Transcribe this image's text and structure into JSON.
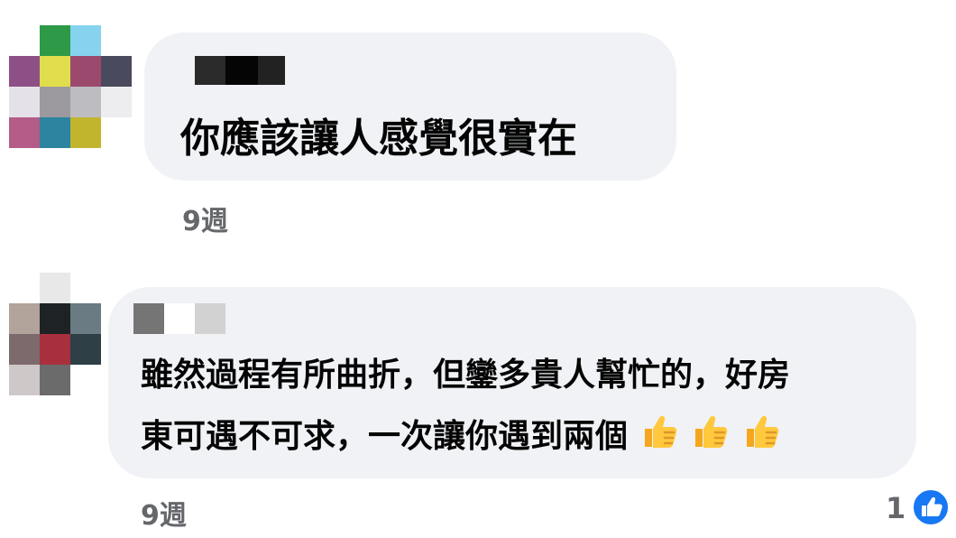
{
  "comments": [
    {
      "avatar_colors": [
        "#ffffff",
        "#2e9a48",
        "#85d3ef",
        "#ffffff",
        "#8e4f86",
        "#e0de4c",
        "#9b4a6e",
        "#4a4a5e",
        "#e4e2e8",
        "#9c9a9e",
        "#bdbdc1",
        "#ededef",
        "#b45c87",
        "#2c84a0",
        "#c2b52e",
        "#ffffff"
      ],
      "text_lines": [
        "你應該讓人感覺很實在"
      ],
      "time": "9週"
    },
    {
      "avatar_colors": [
        "#ffffff",
        "#e8e8e8",
        "#ffffff",
        "#ffffff",
        "#b2a39b",
        "#1f2224",
        "#6a7b83",
        "#ffffff",
        "#7d6a6c",
        "#a8303e",
        "#2e3f46",
        "#ffffff",
        "#cfc8c9",
        "#6b6b6b",
        "#ffffff",
        "#ffffff"
      ],
      "text_lines": [
        "雖然過程有所曲折，但鑾多貴人幫忙的，好房",
        "東可遇不可求，一次讓你遇到兩個"
      ],
      "emoji": [
        "thumbs-up",
        "thumbs-up",
        "thumbs-up"
      ],
      "time": "9週",
      "reaction_count": "1",
      "reaction_type": "like"
    }
  ],
  "colors": {
    "bubble": "#f0f2f5",
    "text": "#050505",
    "meta": "#65676b",
    "like": "#1877f2"
  }
}
